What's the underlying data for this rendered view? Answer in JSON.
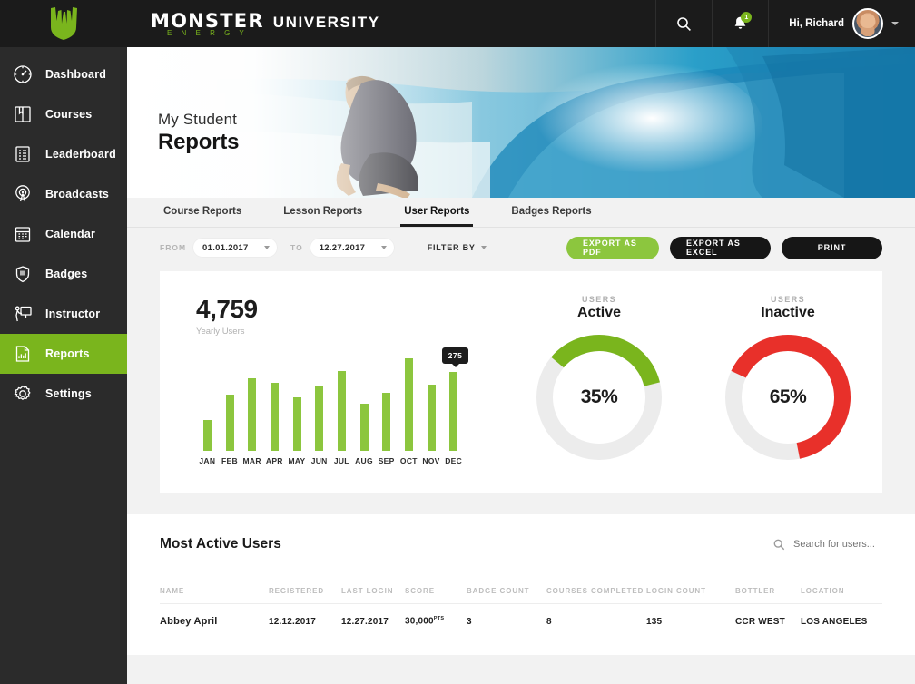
{
  "brand": {
    "monster": "MONSTER",
    "energy": "E N E R G Y",
    "university": "UNIVERSITY"
  },
  "header": {
    "search_icon": "search-icon",
    "bell_icon": "bell-icon",
    "notification_count": "1",
    "greeting": "Hi, Richard"
  },
  "sidebar": {
    "items": [
      {
        "label": "Dashboard",
        "icon": "gauge-icon",
        "active": false
      },
      {
        "label": "Courses",
        "icon": "book-icon",
        "active": false
      },
      {
        "label": "Leaderboard",
        "icon": "list-icon",
        "active": false
      },
      {
        "label": "Broadcasts",
        "icon": "broadcast-icon",
        "active": false
      },
      {
        "label": "Calendar",
        "icon": "calendar-icon",
        "active": false
      },
      {
        "label": "Badges",
        "icon": "shield-icon",
        "active": false
      },
      {
        "label": "Instructor",
        "icon": "instructor-icon",
        "active": false
      },
      {
        "label": "Reports",
        "icon": "report-icon",
        "active": true
      },
      {
        "label": "Settings",
        "icon": "gear-icon",
        "active": false
      }
    ],
    "active_color": "#7ab51d"
  },
  "hero": {
    "subtitle": "My Student",
    "title": "Reports"
  },
  "tabs": [
    {
      "label": "Course Reports",
      "active": false
    },
    {
      "label": "Lesson Reports",
      "active": false
    },
    {
      "label": "User Reports",
      "active": true
    },
    {
      "label": "Badges Reports",
      "active": false
    }
  ],
  "controls": {
    "from_label": "FROM",
    "from_value": "01.01.2017",
    "to_label": "TO",
    "to_value": "12.27.2017",
    "filter_label": "FILTER BY",
    "export_pdf": "EXPORT AS PDF",
    "export_excel": "EXPORT AS EXCEL",
    "print": "PRINT",
    "accent_green": "#8cc63e",
    "dark": "#161616"
  },
  "report": {
    "yearly_total": "4,759",
    "yearly_caption": "Yearly Users",
    "donuts": [
      {
        "cap": "USERS",
        "title": "Active",
        "pct": "35%",
        "value": 35,
        "color": "#7ab51d"
      },
      {
        "cap": "USERS",
        "title": "Inactive",
        "pct": "65%",
        "value": 65,
        "color": "#e8302a"
      }
    ]
  },
  "chart_data": {
    "type": "bar",
    "title": "Yearly Users",
    "xlabel": "",
    "ylabel": "",
    "categories": [
      "JAN",
      "FEB",
      "MAR",
      "APR",
      "MAY",
      "JUN",
      "JUL",
      "AUG",
      "SEP",
      "OCT",
      "NOV",
      "DEC"
    ],
    "values": [
      95,
      175,
      228,
      212,
      166,
      200,
      250,
      148,
      182,
      290,
      208,
      245
    ],
    "ylim": [
      0,
      320
    ],
    "grid": false,
    "legend": null,
    "annotations": [
      {
        "category": "DEC",
        "label": "275",
        "type": "tooltip"
      }
    ],
    "bar_color": "#8cc63e",
    "total_label": "4,759"
  },
  "table": {
    "title": "Most Active Users",
    "search_placeholder": "Search for users...",
    "search_value": "",
    "search_icon": "search-icon",
    "columns": [
      "NAME",
      "REGISTERED",
      "LAST LOGIN",
      "SCORE",
      "BADGE COUNT",
      "COURSES COMPLETED",
      "LOGIN COUNT",
      "BOTTLER",
      "LOCATION"
    ],
    "rows": [
      {
        "name": "Abbey April",
        "registered": "12.12.2017",
        "last_login": "12.27.2017",
        "score": "30,000",
        "score_unit": "PTS",
        "badge_count": "3",
        "courses_completed": "8",
        "login_count": "135",
        "bottler": "CCR WEST",
        "location": "LOS ANGELES"
      }
    ]
  }
}
